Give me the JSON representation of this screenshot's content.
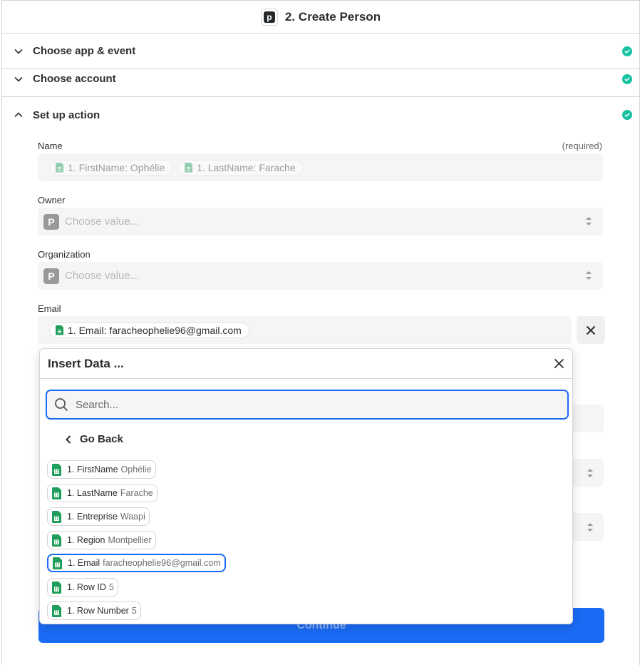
{
  "header": {
    "app_icon": "pipedrive-p-icon",
    "app_letter": "p",
    "title": "2. Create Person"
  },
  "sections": [
    {
      "label": "Choose app & event",
      "status": "complete"
    },
    {
      "label": "Choose account",
      "status": "complete"
    },
    {
      "label": "Set up action",
      "status": "complete"
    }
  ],
  "fields": {
    "name": {
      "label": "Name",
      "required_label": "(required)",
      "tokens": [
        {
          "key": "1. FirstName:",
          "value": "Ophélie"
        },
        {
          "key": "1. LastName:",
          "value": "Farache"
        }
      ]
    },
    "owner": {
      "label": "Owner",
      "placeholder": "Choose value...",
      "icon_letter": "P"
    },
    "organization": {
      "label": "Organization",
      "placeholder": "Choose value...",
      "icon_letter": "P"
    },
    "email": {
      "label": "Email",
      "token": {
        "key": "1. Email:",
        "value": "faracheophelie96@gmail.com"
      }
    }
  },
  "insert_data": {
    "title": "Insert Data ...",
    "search_placeholder": "Search...",
    "go_back": "Go Back",
    "items": [
      {
        "key": "1. FirstName",
        "value": "Ophélie",
        "selected": false
      },
      {
        "key": "1. LastName",
        "value": "Farache",
        "selected": false
      },
      {
        "key": "1. Entreprise",
        "value": "Waapi",
        "selected": false
      },
      {
        "key": "1. Region",
        "value": "Montpellier",
        "selected": false
      },
      {
        "key": "1. Email",
        "value": "faracheophelie96@gmail.com",
        "selected": true
      },
      {
        "key": "1. Row ID",
        "value": "5",
        "selected": false
      },
      {
        "key": "1. Row Number",
        "value": "5",
        "selected": false
      }
    ]
  },
  "continue_label": "Continue",
  "colors": {
    "accent": "#1a6af4",
    "success": "#17c2a3",
    "sheets_green": "#1e9e5a"
  }
}
